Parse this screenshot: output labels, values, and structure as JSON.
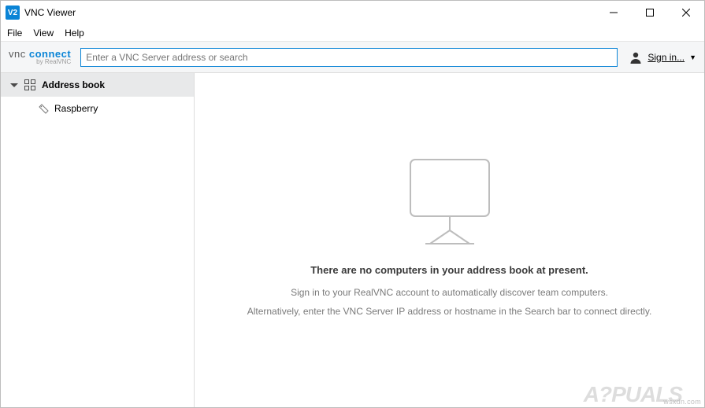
{
  "window": {
    "title": "VNC Viewer"
  },
  "menu": {
    "file": "File",
    "view": "View",
    "help": "Help"
  },
  "toolbar": {
    "logo_main": "vnc connect",
    "logo_sub": "by RealVNC",
    "search_placeholder": "Enter a VNC Server address or search",
    "signin_label": "Sign in..."
  },
  "sidebar": {
    "root_label": "Address book",
    "items": [
      {
        "label": "Raspberry"
      }
    ]
  },
  "empty": {
    "headline": "There are no computers in your address book at present.",
    "hint1": "Sign in to your RealVNC account to automatically discover team computers.",
    "hint2": "Alternatively, enter the VNC Server IP address or hostname in the Search bar to connect directly."
  },
  "watermark": "wsxdn.com",
  "brandmark": "A?PUALS"
}
